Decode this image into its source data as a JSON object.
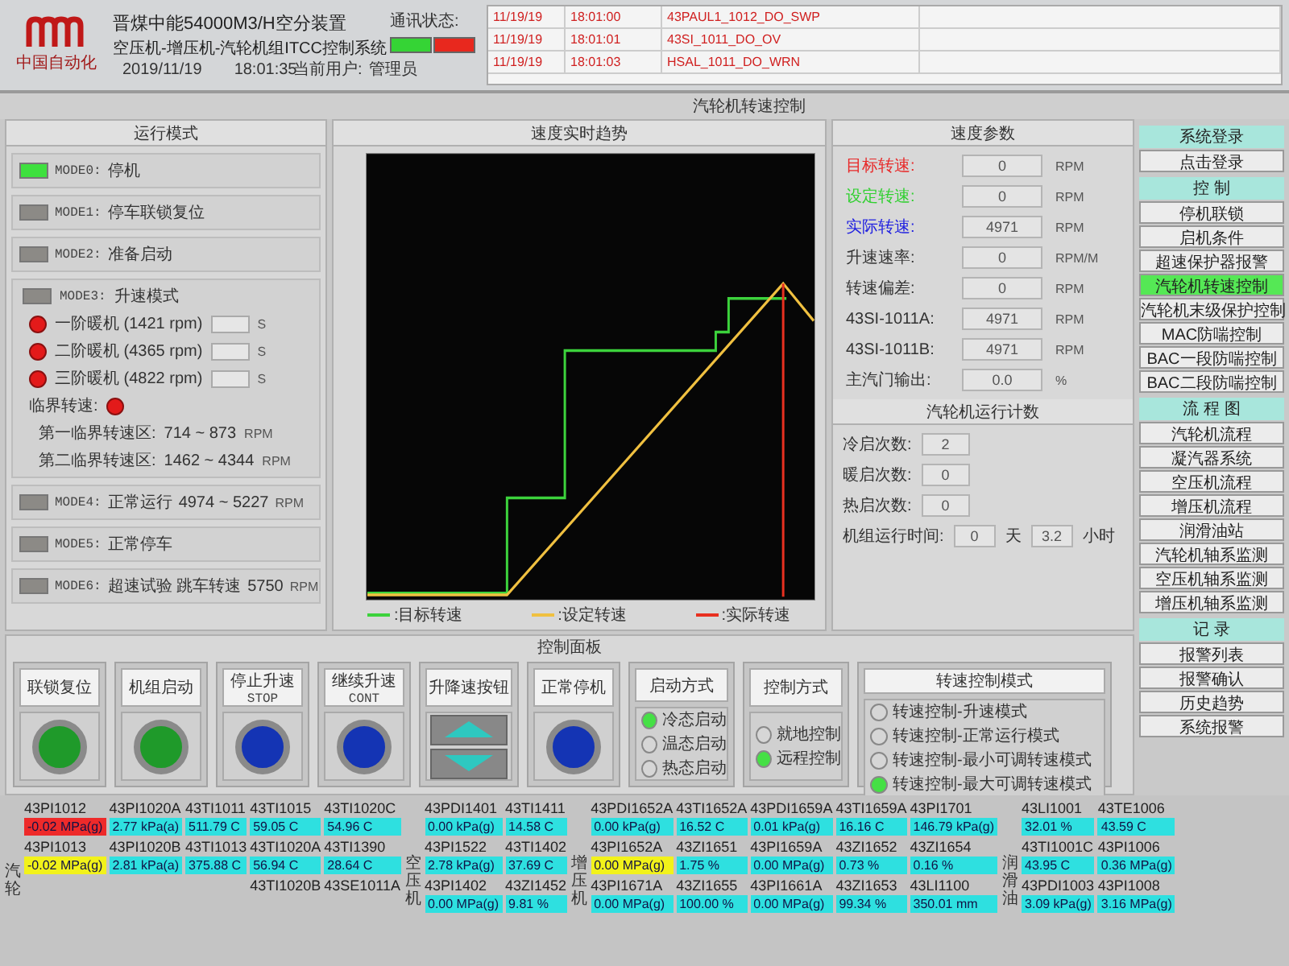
{
  "header": {
    "logo_text": "中国自动化",
    "title_line1": "晋煤中能54000M3/H空分装置",
    "title_line2": "空压机-增压机-汽轮机组ITCC控制系统",
    "date": "2019/11/19",
    "time": "18:01:35",
    "comm_label": "通讯状态:",
    "comm_indicators": [
      {
        "color": "#35d435"
      },
      {
        "color": "#e8281e"
      }
    ],
    "user_label": "当前用户:",
    "user": "管理员"
  },
  "alarms": [
    {
      "date": "11/19/19",
      "time": "18:01:00",
      "tag": "43PAUL1_1012_DO_SWP"
    },
    {
      "date": "11/19/19",
      "time": "18:01:01",
      "tag": "43SI_1011_DO_OV"
    },
    {
      "date": "11/19/19",
      "time": "18:01:03",
      "tag": "HSAL_1011_DO_WRN"
    }
  ],
  "section_title": "汽轮机转速控制",
  "run_mode": {
    "title": "运行模式",
    "modes": [
      {
        "code": "MODE0:",
        "name": "停机",
        "active": true
      },
      {
        "code": "MODE1:",
        "name": "停车联锁复位",
        "active": false
      },
      {
        "code": "MODE2:",
        "name": "准备启动",
        "active": false
      },
      {
        "code": "MODE3:",
        "name": "升速模式",
        "active": false,
        "kind": "ramp"
      },
      {
        "code": "MODE4:",
        "name": "正常运行",
        "range": "4974 ~ 5227",
        "unit": "RPM",
        "active": false
      },
      {
        "code": "MODE5:",
        "name": "正常停车",
        "active": false
      },
      {
        "code": "MODE6:",
        "name": "超速试验 跳车转速",
        "range": "5750",
        "unit": "RPM",
        "active": false
      }
    ],
    "warmups": [
      {
        "label": "一阶暖机 (1421 rpm)",
        "unit": "S",
        "lit": true
      },
      {
        "label": "二阶暖机 (4365 rpm)",
        "unit": "S",
        "lit": true
      },
      {
        "label": "三阶暖机 (4822 rpm)",
        "unit": "S",
        "lit": true
      }
    ],
    "critical": {
      "label": "临界转速:",
      "lit": true,
      "zones": [
        {
          "label": "第一临界转速区:",
          "range": "714 ~ 873",
          "unit": "RPM"
        },
        {
          "label": "第二临界转速区:",
          "range": "1462 ~ 4344",
          "unit": "RPM"
        }
      ]
    }
  },
  "trend": {
    "title": "速度实时趋势",
    "legend": [
      {
        "label": ":目标转速",
        "color": "#3cd23c"
      },
      {
        "label": ":设定转速",
        "color": "#f0c040"
      },
      {
        "label": ":实际转速",
        "color": "#e83020"
      }
    ]
  },
  "speed_params": {
    "title": "速度参数",
    "rows": [
      {
        "label": "目标转速:",
        "value": "0",
        "unit": "RPM",
        "color": "#e82828"
      },
      {
        "label": "设定转速:",
        "value": "0",
        "unit": "RPM",
        "color": "#30d030"
      },
      {
        "label": "实际转速:",
        "value": "4971",
        "unit": "RPM",
        "color": "#2020e0"
      },
      {
        "label": "升速速率:",
        "value": "0",
        "unit": "RPM/M",
        "color": "#333333"
      },
      {
        "label": "转速偏差:",
        "value": "0",
        "unit": "RPM",
        "color": "#333333"
      },
      {
        "label": "43SI-1011A:",
        "value": "4971",
        "unit": "RPM",
        "color": "#333333"
      },
      {
        "label": "43SI-1011B:",
        "value": "4971",
        "unit": "RPM",
        "color": "#333333"
      },
      {
        "label": "主汽门输出:",
        "value": "0.0",
        "unit": "%",
        "color": "#333333"
      }
    ]
  },
  "run_count": {
    "title": "汽轮机运行计数",
    "rows": [
      {
        "label": "冷启次数:",
        "value": "2"
      },
      {
        "label": "暖启次数:",
        "value": "0"
      },
      {
        "label": "热启次数:",
        "value": "0"
      }
    ],
    "runtime": {
      "label": "机组运行时间:",
      "days": "0",
      "days_unit": "天",
      "hours": "3.2",
      "hours_unit": "小时"
    }
  },
  "nav": [
    {
      "title": "系统登录",
      "items": [
        {
          "label": "点击登录",
          "selected": false
        }
      ]
    },
    {
      "title": "控 制",
      "items": [
        {
          "label": "停机联锁",
          "selected": false
        },
        {
          "label": "启机条件",
          "selected": false
        },
        {
          "label": "超速保护器报警",
          "selected": false
        },
        {
          "label": "汽轮机转速控制",
          "selected": true
        },
        {
          "label": "汽轮机末级保护控制",
          "selected": false
        },
        {
          "label": "MAC防喘控制",
          "selected": false
        },
        {
          "label": "BAC一段防喘控制",
          "selected": false
        },
        {
          "label": "BAC二段防喘控制",
          "selected": false
        }
      ]
    },
    {
      "title": "流 程 图",
      "items": [
        {
          "label": "汽轮机流程",
          "selected": false
        },
        {
          "label": "凝汽器系统",
          "selected": false
        },
        {
          "label": "空压机流程",
          "selected": false
        },
        {
          "label": "增压机流程",
          "selected": false
        },
        {
          "label": "润滑油站",
          "selected": false
        },
        {
          "label": "汽轮机轴系监测",
          "selected": false
        },
        {
          "label": "空压机轴系监测",
          "selected": false
        },
        {
          "label": "增压机轴系监测",
          "selected": false
        }
      ]
    },
    {
      "title": "记 录",
      "items": [
        {
          "label": "报警列表",
          "selected": false
        },
        {
          "label": "报警确认",
          "selected": false
        },
        {
          "label": "历史趋势",
          "selected": false
        },
        {
          "label": "系统报警",
          "selected": false
        }
      ]
    }
  ],
  "control_panel": {
    "title": "控制面板",
    "buttons": [
      {
        "label": "联锁复位",
        "kind": "lamp",
        "color": "#1f9a2a"
      },
      {
        "label": "机组启动",
        "kind": "lamp",
        "color": "#1f9a2a"
      },
      {
        "label": "停止升速",
        "sub": "STOP",
        "kind": "lamp",
        "color": "#1434b4"
      },
      {
        "label": "继续升速",
        "sub": "CONT",
        "kind": "lamp",
        "color": "#1434b4"
      },
      {
        "label": "升降速按钮",
        "kind": "arrows"
      },
      {
        "label": "正常停机",
        "kind": "lamp",
        "color": "#1434b4"
      }
    ],
    "option_groups": [
      {
        "title": "启动方式",
        "options": [
          {
            "label": "冷态启动",
            "selected": true
          },
          {
            "label": "温态启动",
            "selected": false
          },
          {
            "label": "热态启动",
            "selected": false
          }
        ]
      },
      {
        "title": "控制方式",
        "options": [
          {
            "label": "就地控制",
            "selected": false
          },
          {
            "label": "远程控制",
            "selected": true
          }
        ]
      },
      {
        "title": "转速控制模式",
        "options": [
          {
            "label": "转速控制-升速模式",
            "selected": false
          },
          {
            "label": "转速控制-正常运行模式",
            "selected": false
          },
          {
            "label": "转速控制-最小可调转速模式",
            "selected": false
          },
          {
            "label": "转速控制-最大可调转速模式",
            "selected": true
          }
        ]
      }
    ]
  },
  "measurements": [
    {
      "group": "汽轮",
      "columns": [
        [
          {
            "tag": "43PI1012",
            "value": "-0.02 MPa(g)",
            "color": "#ee2a2a"
          },
          {
            "tag": "43PI1013",
            "value": "-0.02 MPa(g)",
            "color": "#f2f21a"
          }
        ],
        [
          {
            "tag": "43PI1020A",
            "value": "2.77 kPa(a)",
            "color": "#2ee0e0"
          },
          {
            "tag": "43PI1020B",
            "value": "2.81 kPa(a)",
            "color": "#2ee0e0"
          }
        ],
        [
          {
            "tag": "43TI1011",
            "value": "511.79 C",
            "color": "#2ee0e0"
          },
          {
            "tag": "43TI1013",
            "value": "375.88 C",
            "color": "#2ee0e0"
          }
        ],
        [
          {
            "tag": "43TI1015",
            "value": "59.05 C",
            "color": "#2ee0e0"
          },
          {
            "tag": "43TI1020A",
            "value": "56.94 C",
            "color": "#2ee0e0"
          },
          {
            "tag": "43TI1020B"
          }
        ],
        [
          {
            "tag": "43TI1020C",
            "value": "54.96 C",
            "color": "#2ee0e0"
          },
          {
            "tag": "43TI1390",
            "value": "28.64 C",
            "color": "#2ee0e0"
          },
          {
            "tag": "43SE1011A"
          }
        ]
      ]
    },
    {
      "group": "空压机",
      "columns": [
        [
          {
            "tag": "43PDI1401",
            "value": "0.00 kPa(g)",
            "color": "#2ee0e0"
          },
          {
            "tag": "43PI1522",
            "value": "2.78 kPa(g)",
            "color": "#2ee0e0"
          },
          {
            "tag": "43PI1402",
            "value": "0.00 MPa(g)",
            "color": "#2ee0e0"
          }
        ],
        [
          {
            "tag": "43TI1411",
            "value": "14.58 C",
            "color": "#2ee0e0"
          },
          {
            "tag": "43TI1402",
            "value": "37.69 C",
            "color": "#2ee0e0"
          },
          {
            "tag": "43ZI1452",
            "value": "9.81 %",
            "color": "#2ee0e0"
          }
        ]
      ]
    },
    {
      "group": "增压机",
      "columns": [
        [
          {
            "tag": "43PDI1652A",
            "value": "0.00 kPa(g)",
            "color": "#2ee0e0"
          },
          {
            "tag": "43PI1652A",
            "value": "0.00 MPa(g)",
            "color": "#f2f21a"
          },
          {
            "tag": "43PI1671A",
            "value": "0.00 MPa(g)",
            "color": "#2ee0e0"
          }
        ],
        [
          {
            "tag": "43TI1652A",
            "value": "16.52 C",
            "color": "#2ee0e0"
          },
          {
            "tag": "43ZI1651",
            "value": "1.75 %",
            "color": "#2ee0e0"
          },
          {
            "tag": "43ZI1655",
            "value": "100.00 %",
            "color": "#2ee0e0"
          }
        ],
        [
          {
            "tag": "43PDI1659A",
            "value": "0.01 kPa(g)",
            "color": "#2ee0e0"
          },
          {
            "tag": "43PI1659A",
            "value": "0.00 MPa(g)",
            "color": "#2ee0e0"
          },
          {
            "tag": "43PI1661A",
            "value": "0.00 MPa(g)",
            "color": "#2ee0e0"
          }
        ],
        [
          {
            "tag": "43TI1659A",
            "value": "16.16 C",
            "color": "#2ee0e0"
          },
          {
            "tag": "43ZI1652",
            "value": "0.73 %",
            "color": "#2ee0e0"
          },
          {
            "tag": "43ZI1653",
            "value": "99.34 %",
            "color": "#2ee0e0"
          }
        ],
        [
          {
            "tag": "43PI1701",
            "value": "146.79 kPa(g)",
            "color": "#2ee0e0"
          },
          {
            "tag": "43ZI1654",
            "value": "0.16 %",
            "color": "#2ee0e0"
          },
          {
            "tag": "43LI1100",
            "value": "350.01 mm",
            "color": "#2ee0e0"
          }
        ]
      ]
    },
    {
      "group": "润滑油",
      "columns": [
        [
          {
            "tag": "43LI1001",
            "value": "32.01 %",
            "color": "#2ee0e0"
          },
          {
            "tag": "43TI1001C",
            "value": "43.95 C",
            "color": "#2ee0e0"
          },
          {
            "tag": "43PDI1003",
            "value": "3.09 kPa(g)",
            "color": "#2ee0e0"
          }
        ],
        [
          {
            "tag": "43TE1006",
            "value": "43.59 C",
            "color": "#2ee0e0"
          },
          {
            "tag": "43PI1006",
            "value": "0.36 MPa(g)",
            "color": "#2ee0e0"
          },
          {
            "tag": "43PI1008",
            "value": "3.16 MPa(g)",
            "color": "#2ee0e0"
          }
        ]
      ]
    }
  ]
}
